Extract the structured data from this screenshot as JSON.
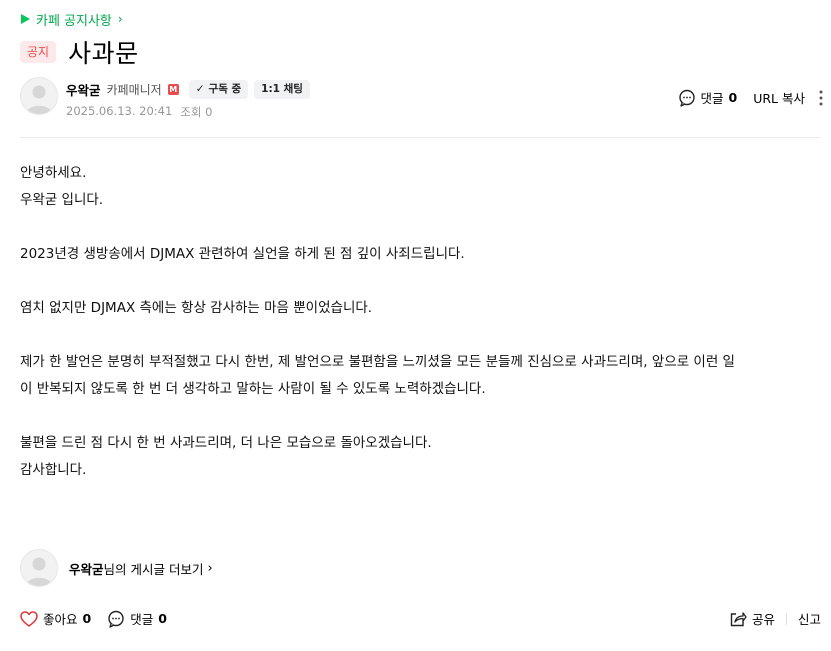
{
  "breadcrumb": {
    "label": "카페 공지사항"
  },
  "post": {
    "badge": "공지",
    "title": "사과문",
    "author": {
      "name": "우왁굳",
      "role": "카페매니저",
      "role_badge": "M",
      "subscribe_label": "구독 중",
      "chat_label": "1:1 채팅"
    },
    "date": "2025.06.13. 20:41",
    "views_label": "조회 0",
    "body": {
      "line1": "안녕하세요.",
      "line2": "우왁굳 입니다.",
      "line3": "2023년경 생방송에서 DJMAX 관련하여 실언을 하게 된 점 깊이 사죄드립니다.",
      "line4": "염치 없지만 DJMAX 측에는 항상 감사하는 마음 뿐이었습니다.",
      "line5": "제가 한 발언은 분명히 부적절했고 다시 한번, 제 발언으로 불편함을 느끼셨을 모든 분들께 진심으로 사과드리며, 앞으로 이런 일",
      "line6": "이 반복되지 않도록 한 번 더 생각하고 말하는 사람이 될 수 있도록 노력하겠습니다.",
      "line7": "불편을 드린 점 다시 한 번 사과드리며, 더 나은 모습으로 돌아오겠습니다.",
      "line8": "감사합니다."
    }
  },
  "header_actions": {
    "comment_label": "댓글",
    "comment_count": "0",
    "url_copy_label": "URL 복사"
  },
  "more_posts": {
    "author_name": "우왁굳",
    "suffix": "님의 게시글 더보기"
  },
  "footer": {
    "like_label": "좋아요",
    "like_count": "0",
    "comment_label": "댓글",
    "comment_count": "0",
    "share_label": "공유",
    "report_label": "신고"
  },
  "colors": {
    "accent_green": "#03c75a",
    "badge_red": "#ea4b4b",
    "badge_bg": "#fde9e9"
  }
}
